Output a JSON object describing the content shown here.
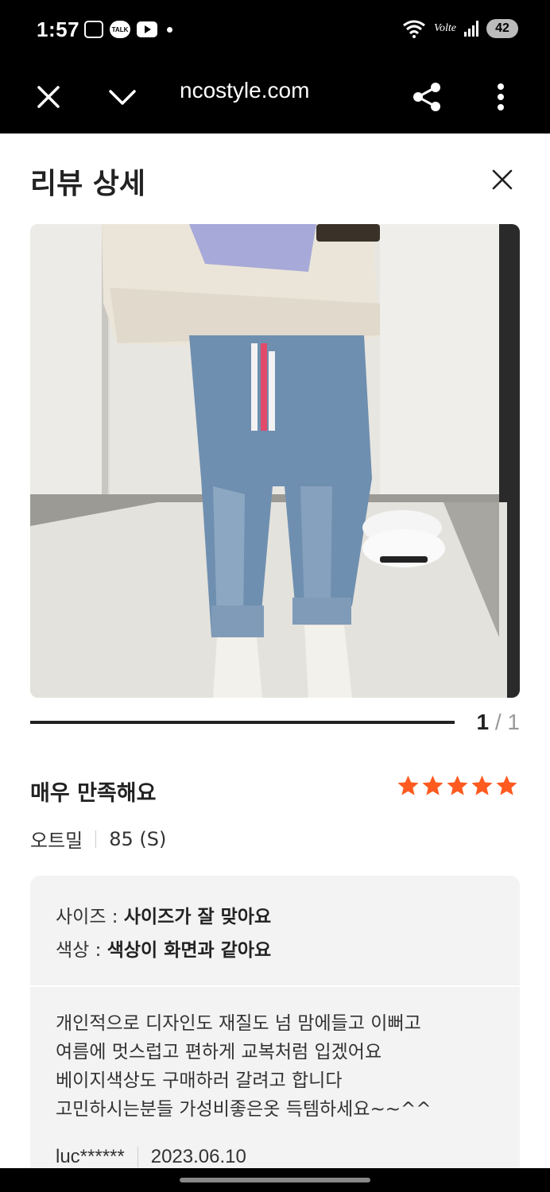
{
  "status_bar": {
    "time": "1:57",
    "talk_label": "TALK",
    "volte_label": "Volte",
    "battery": "42"
  },
  "browser": {
    "url": "ncostyle.com",
    "close_icon": "close-icon",
    "collapse_icon": "chevron-down-icon",
    "share_icon": "share-icon",
    "menu_icon": "more-vertical-icon"
  },
  "header": {
    "title": "리뷰 상세"
  },
  "gallery": {
    "current": "1",
    "separator_total": " / 1"
  },
  "review": {
    "title": "매우 만족해요",
    "rating": 5,
    "star_color": "#ff5a1f",
    "option_color": "오트밀",
    "option_size": "85 (S)",
    "evaluations": [
      {
        "label": "사이즈 : ",
        "value": "사이즈가 잘 맞아요"
      },
      {
        "label": "색상 : ",
        "value": "색상이 화면과 같아요"
      }
    ],
    "body_lines": [
      "개인적으로 디자인도 재질도 넘 맘에들고 이뻐고",
      "여름에 멋스럽고 편하게 교복처럼 입겠어요",
      "베이지색상도 구매하러 갈려고 합니다",
      "고민하시는분들 가성비좋은옷 득템하세요~~^^"
    ],
    "author": "luc******",
    "date": "2023.06.10"
  }
}
